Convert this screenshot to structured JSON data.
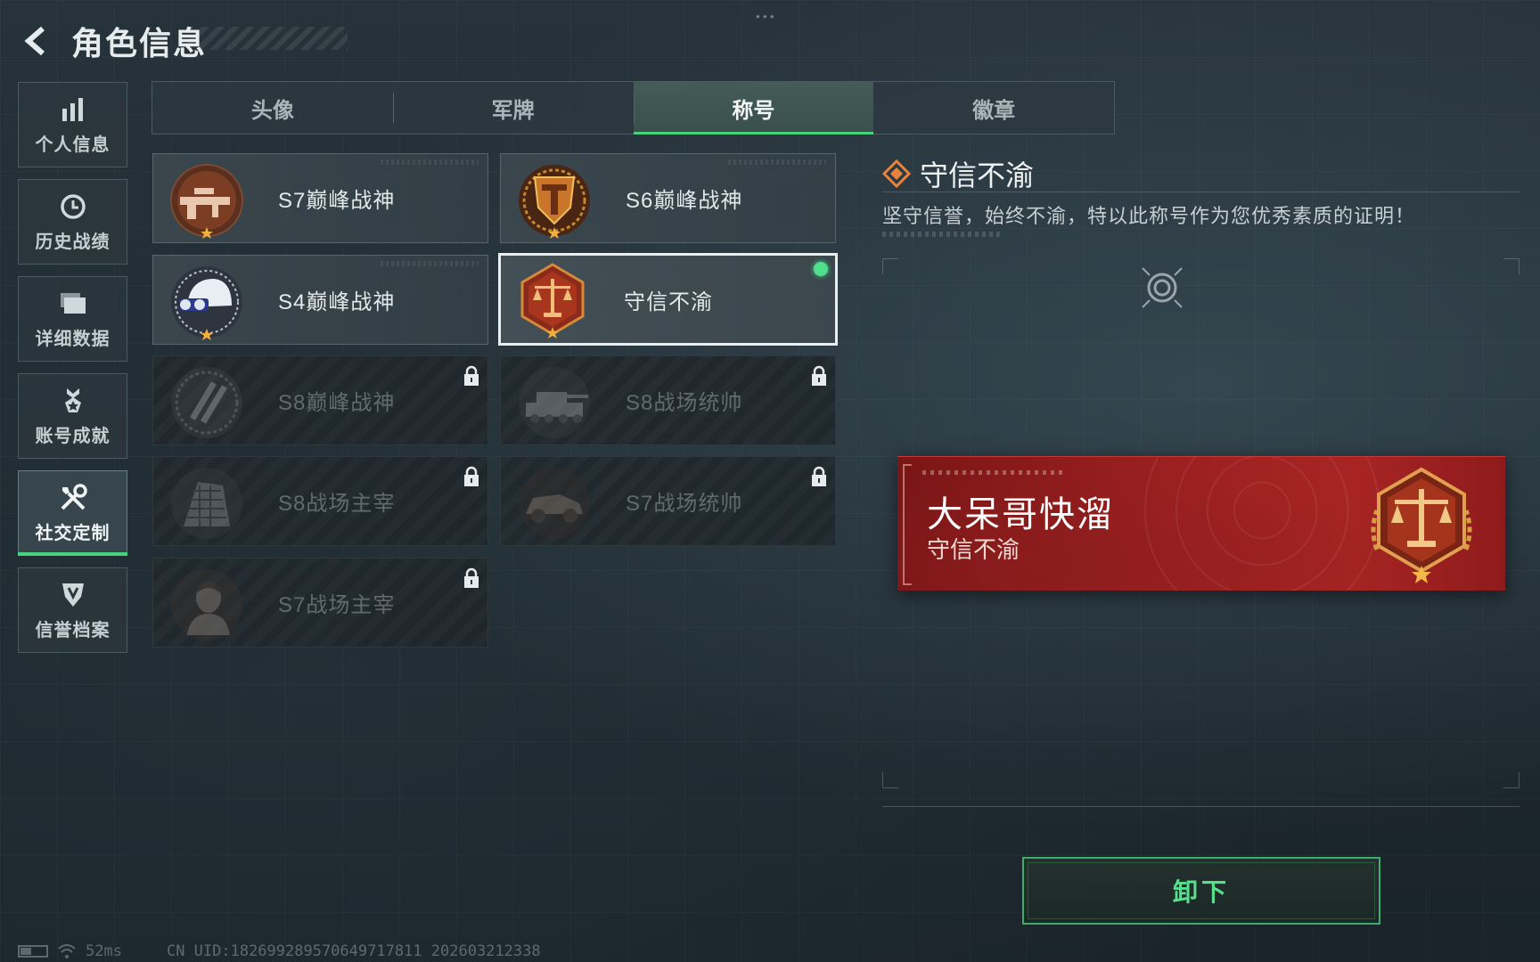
{
  "header": {
    "title": "角色信息"
  },
  "sidebar": {
    "items": [
      {
        "label": "个人信息",
        "icon": "bar-chart-icon"
      },
      {
        "label": "历史战绩",
        "icon": "history-icon"
      },
      {
        "label": "详细数据",
        "icon": "folder-icon"
      },
      {
        "label": "账号成就",
        "icon": "medal-icon"
      },
      {
        "label": "社交定制",
        "icon": "tools-icon",
        "active": true
      },
      {
        "label": "信誉档案",
        "icon": "shield-icon"
      }
    ]
  },
  "tabs": [
    {
      "label": "头像"
    },
    {
      "label": "军牌"
    },
    {
      "label": "称号",
      "active": true
    },
    {
      "label": "徽章"
    }
  ],
  "titles": [
    {
      "label": "S7巅峰战神",
      "state": "owned",
      "emblem": "rifle-emblem-icon"
    },
    {
      "label": "S6巅峰战神",
      "state": "owned",
      "emblem": "shield-t-emblem-icon"
    },
    {
      "label": "S4巅峰战神",
      "state": "owned",
      "emblem": "helmet-emblem-icon"
    },
    {
      "label": "守信不渝",
      "state": "equipped",
      "emblem": "scales-emblem-icon"
    },
    {
      "label": "S8巅峰战神",
      "state": "locked",
      "emblem": "slash-emblem-icon"
    },
    {
      "label": "S8战场统帅",
      "state": "locked",
      "emblem": "tank-emblem-icon"
    },
    {
      "label": "S8战场主宰",
      "state": "locked",
      "emblem": "building-emblem-icon"
    },
    {
      "label": "S7战场统帅",
      "state": "locked",
      "emblem": "vehicle-emblem-icon"
    },
    {
      "label": "S7战场主宰",
      "state": "locked",
      "emblem": "soldier-emblem-icon"
    }
  ],
  "detail": {
    "title": "守信不渝",
    "description": "坚守信誉，始终不渝，特以此称号作为您优秀素质的证明！"
  },
  "nameplate": {
    "player_name": "大呆哥快溜",
    "title": "守信不渝"
  },
  "actions": {
    "unequip_label": "卸下"
  },
  "status": {
    "ping": "52ms",
    "uid": "CN UID:182699289570649717811 202603212338"
  },
  "colors": {
    "accent_green": "#46d27c",
    "nameplate_red": "#9c2020",
    "emblem_bronze": "#b5652a"
  }
}
